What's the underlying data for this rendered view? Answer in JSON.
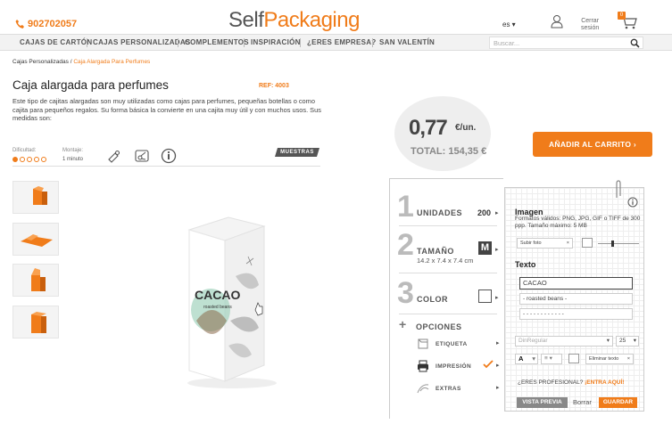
{
  "header": {
    "phone": "902702057",
    "logo_self": "Self",
    "logo_pack": "Packaging",
    "lang": "es",
    "logout_line1": "Cerrar",
    "logout_line2": "sesión",
    "cart_count": "0"
  },
  "nav": {
    "items": [
      "CAJAS DE CARTÓN",
      "CAJAS PERSONALIZADAS",
      "COMPLEMENTOS",
      "INSPIRACIÓN",
      "¿ERES EMPRESA?",
      "SAN VALENTÍN"
    ],
    "search_placeholder": "Buscar..."
  },
  "breadcrumb": {
    "parent": "Cajas Personalizadas",
    "sep": "/",
    "current": "Caja Alargada Para Perfumes"
  },
  "product": {
    "title": "Caja alargada para perfumes",
    "ref": "REF: 4003",
    "description": "Este tipo de cajitas alargadas son muy utilizadas como cajas para perfumes, pequeñas botellas o como cajita para pequeños regalos. Su forma básica la convierte en una cajita muy útil y con muchos usos. Sus medidas son:",
    "difficulty_label": "Dificultad:",
    "difficulty_level": 1,
    "difficulty_max": 5,
    "assembly_label": "Montaje:",
    "assembly_value": "1 minuto",
    "samples_label": "MUESTRAS",
    "tool_icons": [
      "glue-icon",
      "scissors-icon",
      "info-circle-icon"
    ]
  },
  "box_print": {
    "name": "CACAO",
    "sub": "roasted beans"
  },
  "pricing": {
    "price": "0,77",
    "unit": "€/un.",
    "total": "TOTAL: 154,35 €",
    "add_to_cart": "AÑADIR AL CARRITO"
  },
  "config": {
    "step1": {
      "num": "1",
      "label": "UNIDADES",
      "value": "200"
    },
    "step2": {
      "num": "2",
      "label": "TAMAÑO",
      "size": "14.2 x 7.4 x 7.4 cm",
      "value": "M"
    },
    "step3": {
      "num": "3",
      "label": "COLOR"
    },
    "options_label": "OPCIONES",
    "options": [
      {
        "label": "ETIQUETA",
        "icon": "label-icon"
      },
      {
        "label": "IMPRESIÓN",
        "icon": "printer-icon"
      },
      {
        "label": "EXTRAS",
        "icon": "ribbon-icon"
      }
    ]
  },
  "editor": {
    "image_title": "Imagen",
    "image_note": "Formatos válidos: PNG, JPG, GIF o TIFF de 300 ppp. Tamaño máximo: 5 MB",
    "upload_label": "Subir foto",
    "upload_clear": "×",
    "text_title": "Texto",
    "text_lines": [
      "CACAO",
      "- roasted beans -",
      "- - - - - - - - - - - -"
    ],
    "font": "DinRegular",
    "font_size": "25",
    "color_letter": "A",
    "delete_text": "Eliminar texto",
    "delete_icon": "×",
    "pro_question": "¿ERES PROFESIONAL?",
    "pro_link": "¡ENTRA AQUÍ!",
    "preview": "VISTA PREVIA",
    "clear": "Borrar",
    "save": "GUARDAR"
  }
}
